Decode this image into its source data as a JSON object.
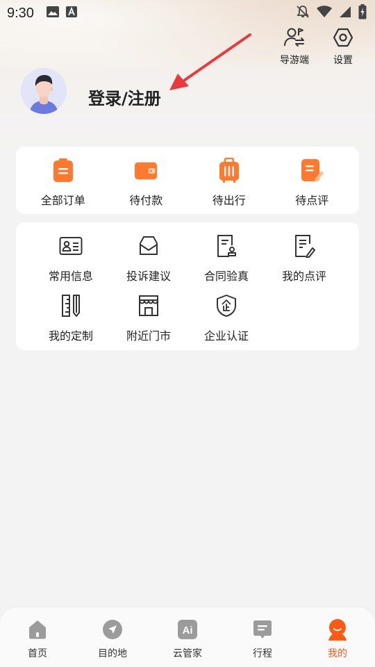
{
  "status_bar": {
    "time": "9:30",
    "icons": [
      "image-icon",
      "a-keyboard-icon",
      "bell-off-icon",
      "wifi-icon",
      "signal-icon",
      "battery-icon"
    ]
  },
  "top_actions": [
    {
      "label": "导游端",
      "icon": "guide-switch-icon"
    },
    {
      "label": "设置",
      "icon": "settings-hexagon-icon"
    }
  ],
  "profile": {
    "login_label": "登录/注册",
    "avatar": "avatar"
  },
  "orders": [
    {
      "label": "全部订单",
      "icon": "clipboard-icon"
    },
    {
      "label": "待付款",
      "icon": "wallet-icon"
    },
    {
      "label": "待出行",
      "icon": "luggage-icon"
    },
    {
      "label": "待点评",
      "icon": "edit-note-icon"
    }
  ],
  "services": [
    {
      "label": "常用信息",
      "icon": "id-card-icon"
    },
    {
      "label": "投诉建议",
      "icon": "mail-box-icon"
    },
    {
      "label": "合同验真",
      "icon": "contract-stamp-icon"
    },
    {
      "label": "我的点评",
      "icon": "review-pen-icon"
    },
    {
      "label": "我的定制",
      "icon": "ruler-icon"
    },
    {
      "label": "附近门市",
      "icon": "store-icon"
    },
    {
      "label": "企业认证",
      "icon": "shield-qi-icon"
    }
  ],
  "bottom_nav": [
    {
      "label": "首页",
      "icon": "home-icon",
      "active": false
    },
    {
      "label": "目的地",
      "icon": "navigation-icon",
      "active": false
    },
    {
      "label": "云管家",
      "icon": "ai-icon",
      "active": false
    },
    {
      "label": "行程",
      "icon": "itinerary-icon",
      "active": false
    },
    {
      "label": "我的",
      "icon": "profile-icon",
      "active": true
    }
  ],
  "colors": {
    "accent": "#ff5a14",
    "orange_icon": "#ff7a2f",
    "nav_icon_gray": "#9b9b9b",
    "annotation_arrow": "#e83a3a"
  }
}
